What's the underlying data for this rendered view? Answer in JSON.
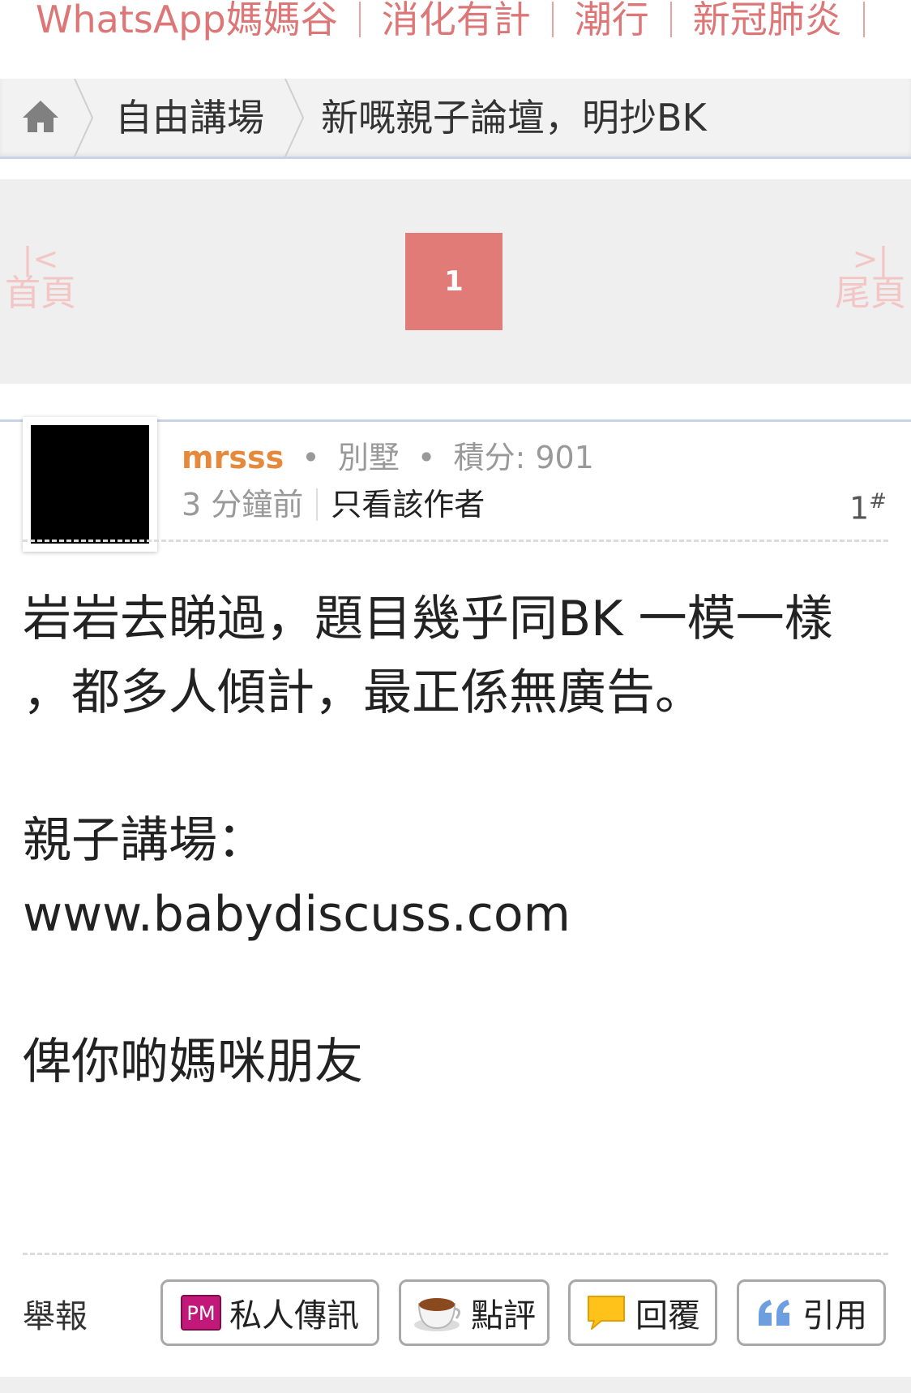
{
  "topnav": {
    "items": [
      "WhatsApp媽媽谷",
      "消化有計",
      "潮行",
      "新冠肺炎"
    ]
  },
  "breadcrumb": {
    "items": [
      "自由講場",
      "新嘅親子論壇，明抄BK"
    ]
  },
  "pager": {
    "first_label": "首頁",
    "last_label": "尾頁",
    "current_page": "1"
  },
  "post": {
    "username": "mrsss",
    "rank": "別墅",
    "score": "積分: 901",
    "time": "3 分鐘前",
    "author_only": "只看該作者",
    "floor": "1",
    "floor_mark": "#",
    "content": [
      "岩岩去睇過，題目幾乎同BK 一模一樣",
      "，都多人傾計，最正係無廣告。",
      "",
      "親子講場：",
      "www.babydiscuss.com",
      "",
      "俾你啲媽咪朋友"
    ]
  },
  "actions": {
    "report": "舉報",
    "pm": "私人傳訊",
    "pm_icon_text": "PM",
    "comment": "點評",
    "reply": "回覆",
    "quote": "引用"
  },
  "colors": {
    "accent": "#dd7777",
    "page_active": "#e07b78",
    "username": "#e58a3d"
  }
}
